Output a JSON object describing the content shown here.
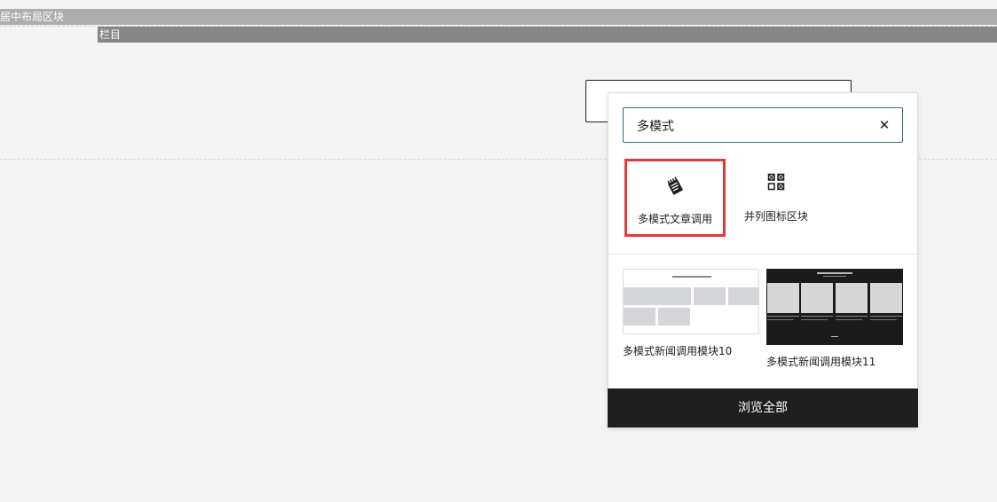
{
  "canvas": {
    "outer_block_label": "居中布局区块",
    "column_label": "栏目"
  },
  "inserter": {
    "search": {
      "value": "多模式",
      "placeholder": ""
    },
    "clear_icon": "close-icon",
    "blocks": [
      {
        "label": "多模式文章调用",
        "icon": "notepad-icon",
        "selected": true
      },
      {
        "label": "并列图标区块",
        "icon": "grid-icon",
        "selected": false
      }
    ],
    "patterns": [
      {
        "label": "多模式新闻调用模块10"
      },
      {
        "label": "多模式新闻调用模块11"
      }
    ],
    "browse_all_label": "浏览全部"
  },
  "colors": {
    "selection_border": "#e23b3b",
    "search_border": "#3a6e7d",
    "browse_bg": "#1e1e1e"
  }
}
